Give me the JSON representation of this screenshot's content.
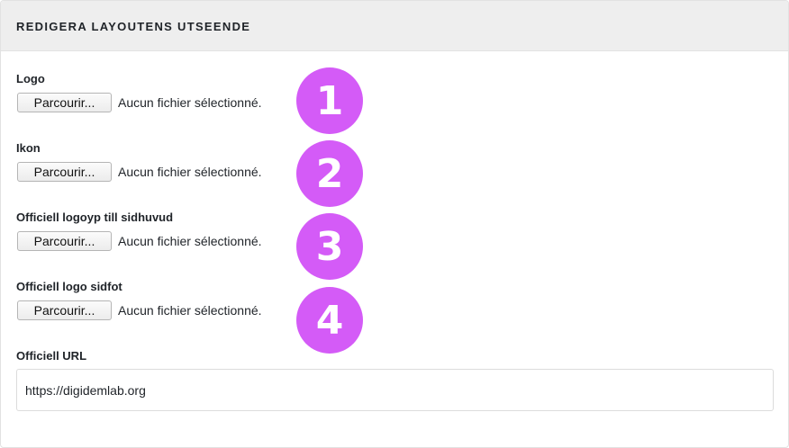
{
  "panel": {
    "title": "REDIGERA LAYOUTENS UTSEENDE"
  },
  "fields": [
    {
      "label": "Logo",
      "button_label": "Parcourir...",
      "status": "Aucun fichier sélectionné.",
      "marker": "1"
    },
    {
      "label": "Ikon",
      "button_label": "Parcourir...",
      "status": "Aucun fichier sélectionné.",
      "marker": "2"
    },
    {
      "label": "Officiell logoyp till sidhuvud",
      "button_label": "Parcourir...",
      "status": "Aucun fichier sélectionné.",
      "marker": "3"
    },
    {
      "label": "Officiell logo sidfot",
      "button_label": "Parcourir...",
      "status": "Aucun fichier sélectionné.",
      "marker": "4"
    }
  ],
  "url_field": {
    "label": "Officiell URL",
    "value": "https://digidemlab.org"
  },
  "colors": {
    "marker": "#d45bf7",
    "header_bg": "#eeeeee"
  }
}
